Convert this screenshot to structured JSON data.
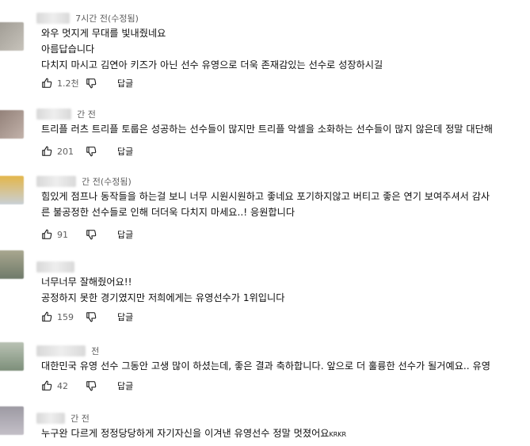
{
  "comments": [
    {
      "time": "7시간 전(수정됨)",
      "lines": [
        "와우 멋지게 무대를 빛내줬네요",
        "아름답습니다",
        "다치지 마시고 김연아 키즈가 아닌 선수 유영으로 더욱 존재감있는 선수로 성장하시길"
      ],
      "likes": "1.2천",
      "reply": "답글"
    },
    {
      "time": "간 전",
      "lines": [
        "트리플 러츠 트리플 토룹은 성공하는 선수들이 많지만 트리플 악셀을 소화하는 선수들이 많지 않은데 정말 대단해"
      ],
      "likes": "201",
      "reply": "답글"
    },
    {
      "time": "간 전(수정됨)",
      "lines": [
        "힘있게 점프나 동작들을 하는걸 보니 너무 시원시원하고 좋네요 포기하지않고 버티고 좋은 연기 보여주셔서 감사",
        "른 불공정한 선수들로 인해 더더욱 다치지 마세요..! 응원합니다"
      ],
      "likes": "91",
      "reply": "답글"
    },
    {
      "time": "",
      "lines": [
        "너무너무 잘해줬어요!!",
        "공정하지 못한 경기였지만 저희에게는 유영선수가 1위입니다"
      ],
      "likes": "159",
      "reply": "답글"
    },
    {
      "time": "전",
      "lines": [
        "대한민국 유영 선수 그동안 고생 많이 하셨는데, 좋은 결과 축하합니다. 앞으로 더 훌륭한 선수가 될거예요.. 유영"
      ],
      "likes": "42",
      "reply": "답글"
    },
    {
      "time": "간 전",
      "lines": [
        "누구완 다르게 정정당당하게 자기자신을 이겨낸 유영선수 정말 멋졌어요"
      ],
      "suffix": "KRKR"
    }
  ]
}
